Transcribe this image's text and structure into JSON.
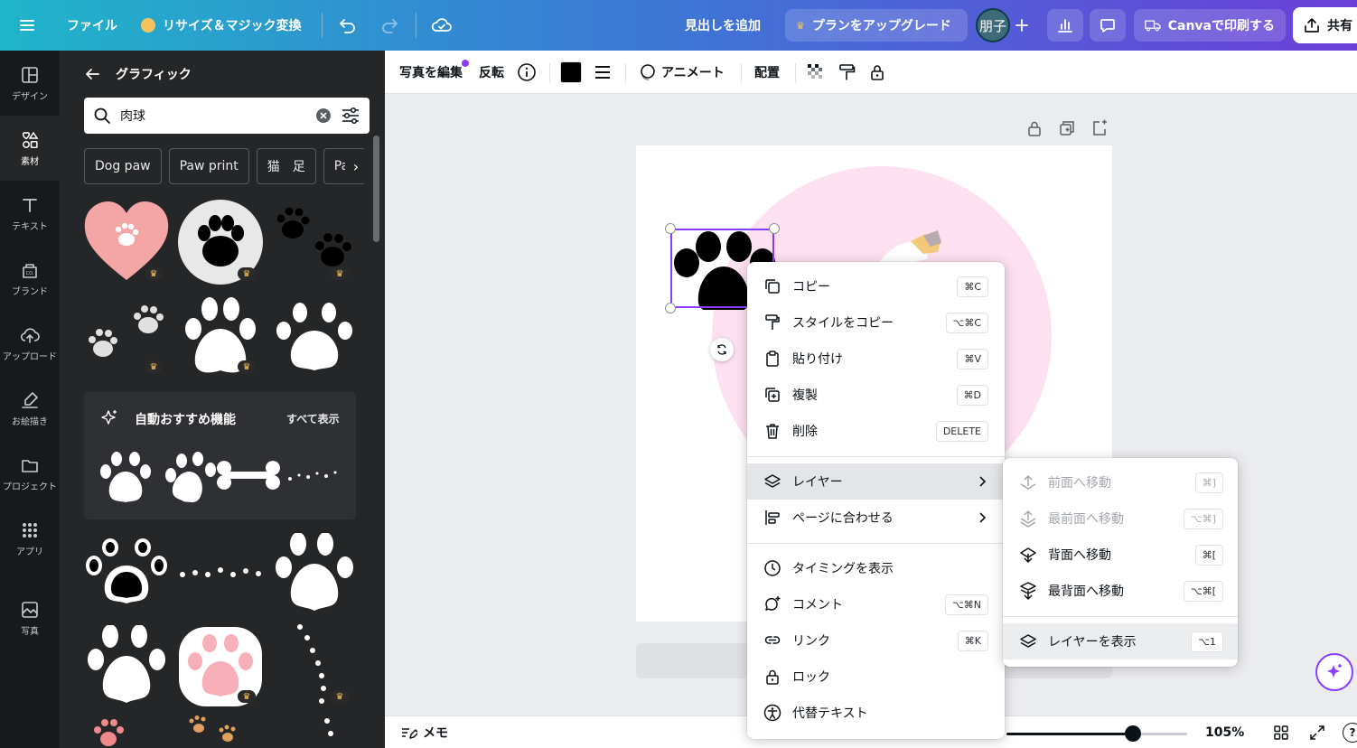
{
  "topbar": {
    "menu_icon": "hamburger-icon",
    "file": "ファイル",
    "resize": "リサイズ＆マジック変換",
    "add_heading": "見出しを追加",
    "upgrade": "プランをアップグレード",
    "avatar": "朋子",
    "print": "Canvaで印刷する",
    "share": "共有"
  },
  "rail": {
    "items": [
      {
        "label": "デザイン",
        "icon": "layout-icon"
      },
      {
        "label": "素材",
        "icon": "shapes-icon"
      },
      {
        "label": "テキスト",
        "icon": "text-icon"
      },
      {
        "label": "ブランド",
        "icon": "brand-icon"
      },
      {
        "label": "アップロード",
        "icon": "cloud-upload-icon"
      },
      {
        "label": "お絵描き",
        "icon": "draw-icon"
      },
      {
        "label": "プロジェクト",
        "icon": "folder-icon"
      },
      {
        "label": "アプリ",
        "icon": "apps-icon"
      },
      {
        "label": "写真",
        "icon": "photo-icon"
      }
    ]
  },
  "panel": {
    "title": "グラフィック",
    "search_value": "肉球",
    "chips": [
      "Dog paw",
      "Paw print",
      "猫　足",
      "Paw"
    ],
    "auto_title": "自動おすすめ機能",
    "see_all": "すべて表示"
  },
  "toolbar": {
    "edit_photo": "写真を編集",
    "flip": "反転",
    "animate": "アニメート",
    "position": "配置"
  },
  "context_menu": {
    "items": [
      {
        "label": "コピー",
        "shortcut": "⌘C",
        "icon": "copy-icon"
      },
      {
        "label": "スタイルをコピー",
        "shortcut": "⌥⌘C",
        "icon": "paint-roller-icon"
      },
      {
        "label": "貼り付け",
        "shortcut": "⌘V",
        "icon": "clipboard-icon"
      },
      {
        "label": "複製",
        "shortcut": "⌘D",
        "icon": "duplicate-icon"
      },
      {
        "label": "削除",
        "shortcut": "DELETE",
        "icon": "trash-icon"
      },
      {
        "label": "レイヤー",
        "icon": "layers-icon"
      },
      {
        "label": "ページに合わせる",
        "icon": "align-icon"
      },
      {
        "label": "タイミングを表示",
        "icon": "clock-icon"
      },
      {
        "label": "コメント",
        "shortcut": "⌥⌘N",
        "icon": "comment-icon"
      },
      {
        "label": "リンク",
        "shortcut": "⌘K",
        "icon": "link-icon"
      },
      {
        "label": "ロック",
        "icon": "lock-icon"
      },
      {
        "label": "代替テキスト",
        "icon": "accessibility-icon"
      }
    ]
  },
  "layer_submenu": {
    "items": [
      {
        "label": "前面へ移動",
        "shortcut": "⌘]",
        "disabled": true
      },
      {
        "label": "最前面へ移動",
        "shortcut": "⌥⌘]",
        "disabled": true
      },
      {
        "label": "背面へ移動",
        "shortcut": "⌘[",
        "disabled": false
      },
      {
        "label": "最背面へ移動",
        "shortcut": "⌥⌘[",
        "disabled": false
      },
      {
        "label": "レイヤーを表示",
        "shortcut": "⌥1",
        "disabled": false
      }
    ]
  },
  "bottombar": {
    "notes": "メモ",
    "zoom": "105%",
    "zoom_level": 0.7
  },
  "colors": {
    "accent": "#8b3dff",
    "panel_bg": "#252627",
    "rail_bg": "#18191b",
    "pink_circle": "#fde1f1",
    "heart": "#f4a5a5"
  }
}
